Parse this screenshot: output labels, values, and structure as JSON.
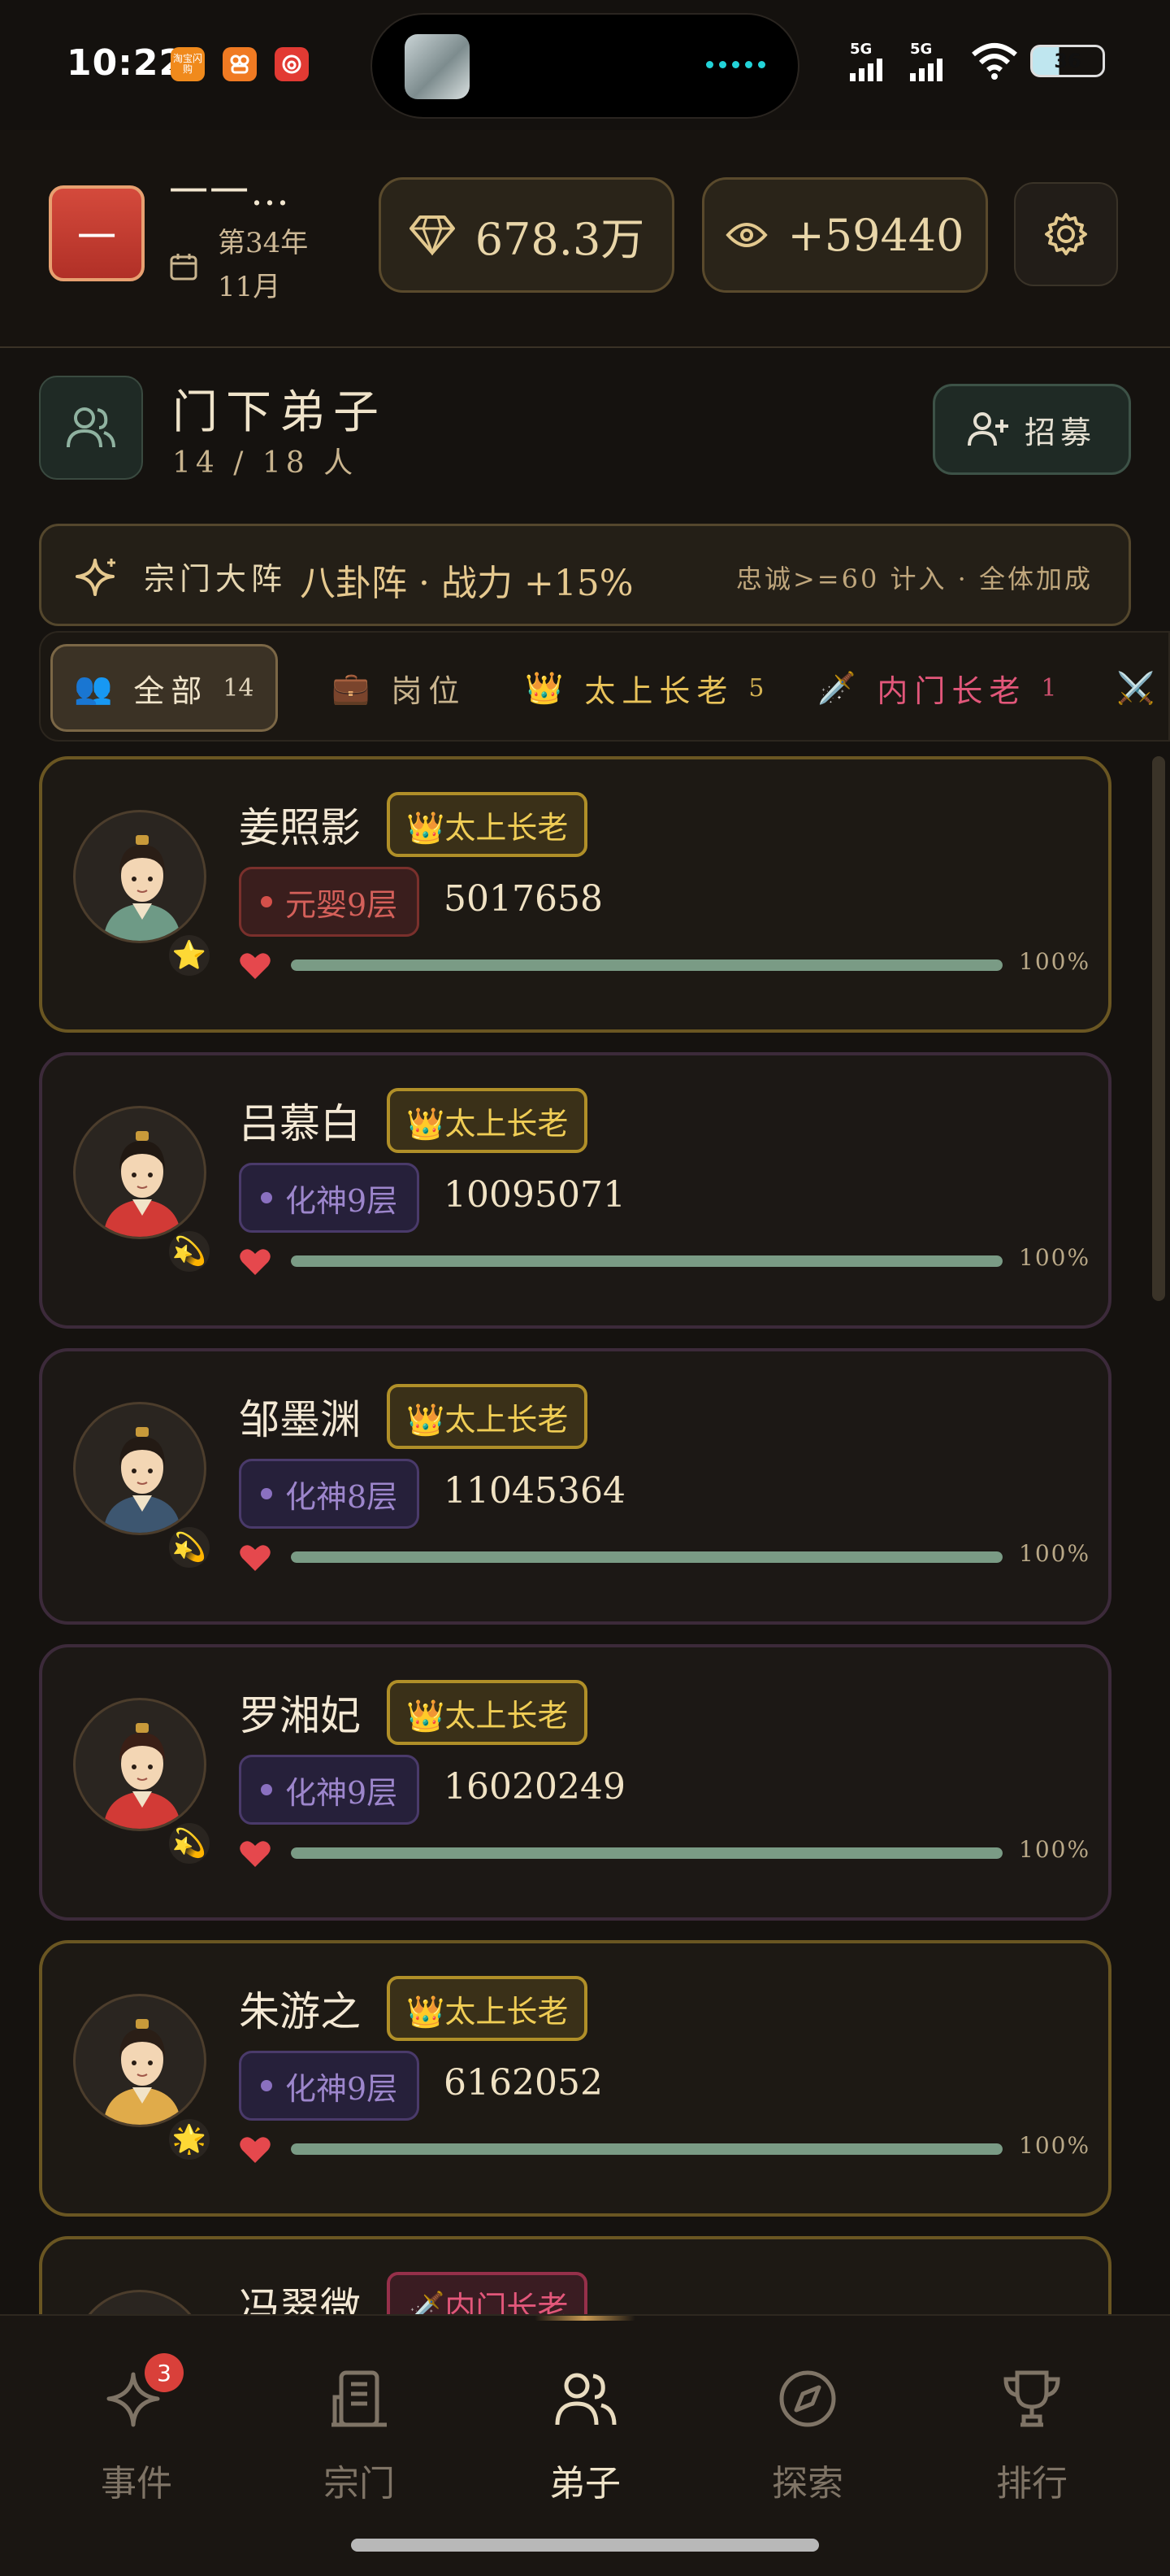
{
  "status_bar": {
    "time": "10:22",
    "apps": [
      {
        "label": "淘宝闪购",
        "color": "#f08a1c"
      },
      {
        "label": "",
        "color": "#f07a22"
      },
      {
        "label": "",
        "color": "#e23a33"
      }
    ],
    "signal_1": "5G",
    "signal_2": "5G",
    "battery": "36"
  },
  "header": {
    "sect_avatar": "一",
    "sect_name": "一一…",
    "date": "第34年11月",
    "spirit_stones": "678.3万",
    "views": "+59440"
  },
  "section": {
    "title": "门下弟子",
    "count": "14 / 18 人",
    "recruit_label": "招募"
  },
  "formation": {
    "label": "宗门大阵",
    "value": "八卦阵 · 战力 +15%",
    "note": "忠诚>=60 计入 · 全体加成"
  },
  "tabs": [
    {
      "icon": "👥",
      "label": "全部",
      "count": "14",
      "color": "#f1e5cb"
    },
    {
      "icon": "💼",
      "label": "岗位",
      "count": "",
      "color": "#c9b48e"
    },
    {
      "icon": "👑",
      "label": "太上长老",
      "count": "5",
      "color": "#e9c35a"
    },
    {
      "icon": "🗡️",
      "label": "内门长老",
      "count": "1",
      "color": "#e2577a"
    },
    {
      "icon": "⚔️",
      "label": "",
      "count": "",
      "color": "#c9b48e"
    }
  ],
  "disciples": [
    {
      "name": "姜照影",
      "role": "👑太上长老",
      "role_type": "elder",
      "realm": "元婴9层",
      "realm_type": "red",
      "power": "5017658",
      "loyalty": 100,
      "loyalty_text": "100%",
      "badge": "⭐",
      "border": "gold",
      "robe": "#6e9a86",
      "hair": "#2a1e16"
    },
    {
      "name": "吕慕白",
      "role": "👑太上长老",
      "role_type": "elder",
      "realm": "化神9层",
      "realm_type": "violet",
      "power": "10095071",
      "loyalty": 100,
      "loyalty_text": "100%",
      "badge": "💫",
      "border": "purple",
      "robe": "#d23a36",
      "hair": "#201812"
    },
    {
      "name": "邹墨渊",
      "role": "👑太上长老",
      "role_type": "elder",
      "realm": "化神8层",
      "realm_type": "violet",
      "power": "11045364",
      "loyalty": 100,
      "loyalty_text": "100%",
      "badge": "💫",
      "border": "purple",
      "robe": "#3d5670",
      "hair": "#231a14"
    },
    {
      "name": "罗湘妃",
      "role": "👑太上长老",
      "role_type": "elder",
      "realm": "化神9层",
      "realm_type": "violet",
      "power": "16020249",
      "loyalty": 100,
      "loyalty_text": "100%",
      "badge": "💫",
      "border": "purple",
      "robe": "#d23a36",
      "hair": "#3a1f16"
    },
    {
      "name": "朱游之",
      "role": "👑太上长老",
      "role_type": "elder",
      "realm": "化神9层",
      "realm_type": "violet",
      "power": "6162052",
      "loyalty": 100,
      "loyalty_text": "100%",
      "badge": "🌟",
      "border": "gold",
      "robe": "#e0ab4a",
      "hair": "#2a1e16"
    },
    {
      "name": "冯翠微",
      "role": "🗡️内门长老",
      "role_type": "inner",
      "realm": "",
      "realm_type": "violet",
      "power": "",
      "loyalty": 100,
      "loyalty_text": "",
      "badge": "",
      "border": "gold",
      "robe": "#6e9a86",
      "hair": "#2a1e16"
    }
  ],
  "bottom_nav": [
    {
      "label": "事件",
      "icon": "sparkle-icon",
      "badge": "3"
    },
    {
      "label": "宗门",
      "icon": "building-icon",
      "badge": ""
    },
    {
      "label": "弟子",
      "icon": "users-icon",
      "badge": ""
    },
    {
      "label": "探索",
      "icon": "compass-icon",
      "badge": ""
    },
    {
      "label": "排行",
      "icon": "trophy-icon",
      "badge": ""
    }
  ]
}
